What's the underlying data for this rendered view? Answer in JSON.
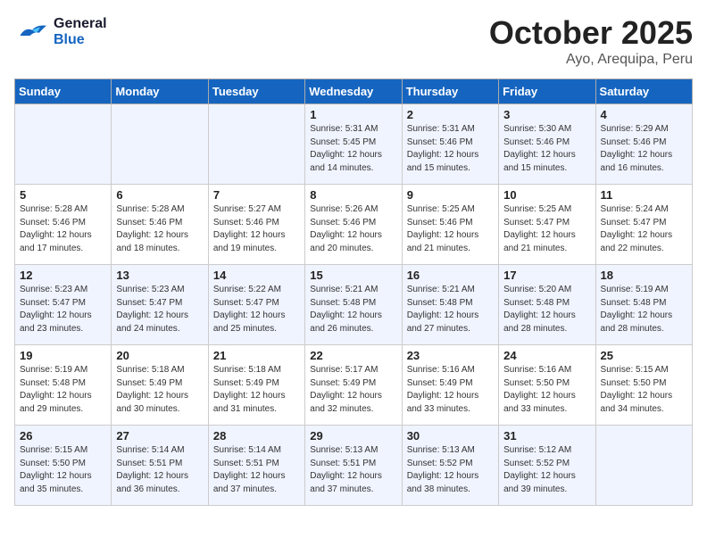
{
  "header": {
    "logo": {
      "general": "General",
      "blue": "Blue"
    },
    "month": "October 2025",
    "location": "Ayo, Arequipa, Peru"
  },
  "weekdays": [
    "Sunday",
    "Monday",
    "Tuesday",
    "Wednesday",
    "Thursday",
    "Friday",
    "Saturday"
  ],
  "weeks": [
    [
      {
        "day": "",
        "sunrise": "",
        "sunset": "",
        "daylight": ""
      },
      {
        "day": "",
        "sunrise": "",
        "sunset": "",
        "daylight": ""
      },
      {
        "day": "",
        "sunrise": "",
        "sunset": "",
        "daylight": ""
      },
      {
        "day": "1",
        "sunrise": "Sunrise: 5:31 AM",
        "sunset": "Sunset: 5:45 PM",
        "daylight": "Daylight: 12 hours and 14 minutes."
      },
      {
        "day": "2",
        "sunrise": "Sunrise: 5:31 AM",
        "sunset": "Sunset: 5:46 PM",
        "daylight": "Daylight: 12 hours and 15 minutes."
      },
      {
        "day": "3",
        "sunrise": "Sunrise: 5:30 AM",
        "sunset": "Sunset: 5:46 PM",
        "daylight": "Daylight: 12 hours and 15 minutes."
      },
      {
        "day": "4",
        "sunrise": "Sunrise: 5:29 AM",
        "sunset": "Sunset: 5:46 PM",
        "daylight": "Daylight: 12 hours and 16 minutes."
      }
    ],
    [
      {
        "day": "5",
        "sunrise": "Sunrise: 5:28 AM",
        "sunset": "Sunset: 5:46 PM",
        "daylight": "Daylight: 12 hours and 17 minutes."
      },
      {
        "day": "6",
        "sunrise": "Sunrise: 5:28 AM",
        "sunset": "Sunset: 5:46 PM",
        "daylight": "Daylight: 12 hours and 18 minutes."
      },
      {
        "day": "7",
        "sunrise": "Sunrise: 5:27 AM",
        "sunset": "Sunset: 5:46 PM",
        "daylight": "Daylight: 12 hours and 19 minutes."
      },
      {
        "day": "8",
        "sunrise": "Sunrise: 5:26 AM",
        "sunset": "Sunset: 5:46 PM",
        "daylight": "Daylight: 12 hours and 20 minutes."
      },
      {
        "day": "9",
        "sunrise": "Sunrise: 5:25 AM",
        "sunset": "Sunset: 5:46 PM",
        "daylight": "Daylight: 12 hours and 21 minutes."
      },
      {
        "day": "10",
        "sunrise": "Sunrise: 5:25 AM",
        "sunset": "Sunset: 5:47 PM",
        "daylight": "Daylight: 12 hours and 21 minutes."
      },
      {
        "day": "11",
        "sunrise": "Sunrise: 5:24 AM",
        "sunset": "Sunset: 5:47 PM",
        "daylight": "Daylight: 12 hours and 22 minutes."
      }
    ],
    [
      {
        "day": "12",
        "sunrise": "Sunrise: 5:23 AM",
        "sunset": "Sunset: 5:47 PM",
        "daylight": "Daylight: 12 hours and 23 minutes."
      },
      {
        "day": "13",
        "sunrise": "Sunrise: 5:23 AM",
        "sunset": "Sunset: 5:47 PM",
        "daylight": "Daylight: 12 hours and 24 minutes."
      },
      {
        "day": "14",
        "sunrise": "Sunrise: 5:22 AM",
        "sunset": "Sunset: 5:47 PM",
        "daylight": "Daylight: 12 hours and 25 minutes."
      },
      {
        "day": "15",
        "sunrise": "Sunrise: 5:21 AM",
        "sunset": "Sunset: 5:48 PM",
        "daylight": "Daylight: 12 hours and 26 minutes."
      },
      {
        "day": "16",
        "sunrise": "Sunrise: 5:21 AM",
        "sunset": "Sunset: 5:48 PM",
        "daylight": "Daylight: 12 hours and 27 minutes."
      },
      {
        "day": "17",
        "sunrise": "Sunrise: 5:20 AM",
        "sunset": "Sunset: 5:48 PM",
        "daylight": "Daylight: 12 hours and 28 minutes."
      },
      {
        "day": "18",
        "sunrise": "Sunrise: 5:19 AM",
        "sunset": "Sunset: 5:48 PM",
        "daylight": "Daylight: 12 hours and 28 minutes."
      }
    ],
    [
      {
        "day": "19",
        "sunrise": "Sunrise: 5:19 AM",
        "sunset": "Sunset: 5:48 PM",
        "daylight": "Daylight: 12 hours and 29 minutes."
      },
      {
        "day": "20",
        "sunrise": "Sunrise: 5:18 AM",
        "sunset": "Sunset: 5:49 PM",
        "daylight": "Daylight: 12 hours and 30 minutes."
      },
      {
        "day": "21",
        "sunrise": "Sunrise: 5:18 AM",
        "sunset": "Sunset: 5:49 PM",
        "daylight": "Daylight: 12 hours and 31 minutes."
      },
      {
        "day": "22",
        "sunrise": "Sunrise: 5:17 AM",
        "sunset": "Sunset: 5:49 PM",
        "daylight": "Daylight: 12 hours and 32 minutes."
      },
      {
        "day": "23",
        "sunrise": "Sunrise: 5:16 AM",
        "sunset": "Sunset: 5:49 PM",
        "daylight": "Daylight: 12 hours and 33 minutes."
      },
      {
        "day": "24",
        "sunrise": "Sunrise: 5:16 AM",
        "sunset": "Sunset: 5:50 PM",
        "daylight": "Daylight: 12 hours and 33 minutes."
      },
      {
        "day": "25",
        "sunrise": "Sunrise: 5:15 AM",
        "sunset": "Sunset: 5:50 PM",
        "daylight": "Daylight: 12 hours and 34 minutes."
      }
    ],
    [
      {
        "day": "26",
        "sunrise": "Sunrise: 5:15 AM",
        "sunset": "Sunset: 5:50 PM",
        "daylight": "Daylight: 12 hours and 35 minutes."
      },
      {
        "day": "27",
        "sunrise": "Sunrise: 5:14 AM",
        "sunset": "Sunset: 5:51 PM",
        "daylight": "Daylight: 12 hours and 36 minutes."
      },
      {
        "day": "28",
        "sunrise": "Sunrise: 5:14 AM",
        "sunset": "Sunset: 5:51 PM",
        "daylight": "Daylight: 12 hours and 37 minutes."
      },
      {
        "day": "29",
        "sunrise": "Sunrise: 5:13 AM",
        "sunset": "Sunset: 5:51 PM",
        "daylight": "Daylight: 12 hours and 37 minutes."
      },
      {
        "day": "30",
        "sunrise": "Sunrise: 5:13 AM",
        "sunset": "Sunset: 5:52 PM",
        "daylight": "Daylight: 12 hours and 38 minutes."
      },
      {
        "day": "31",
        "sunrise": "Sunrise: 5:12 AM",
        "sunset": "Sunset: 5:52 PM",
        "daylight": "Daylight: 12 hours and 39 minutes."
      },
      {
        "day": "",
        "sunrise": "",
        "sunset": "",
        "daylight": ""
      }
    ]
  ]
}
